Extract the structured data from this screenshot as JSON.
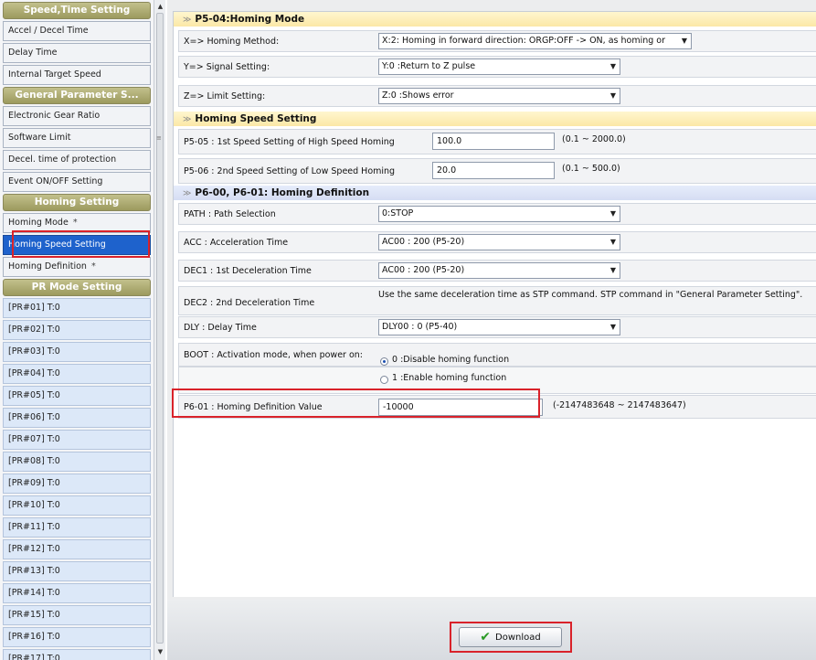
{
  "sidebar": {
    "groups": [
      {
        "title": "Speed,Time Setting",
        "items": [
          {
            "label": "Accel / Decel Time"
          },
          {
            "label": "Delay Time"
          },
          {
            "label": "Internal Target Speed"
          }
        ]
      },
      {
        "title": "General Parameter S...",
        "items": [
          {
            "label": "Electronic Gear Ratio"
          },
          {
            "label": "Software Limit"
          },
          {
            "label": "Decel. time of protection"
          },
          {
            "label": "Event ON/OFF Setting"
          }
        ]
      },
      {
        "title": "Homing Setting",
        "items": [
          {
            "label": "Homing Mode",
            "star": "*"
          },
          {
            "label": "Homing Speed Setting",
            "selected": true
          },
          {
            "label": "Homing Definition",
            "star": "*"
          }
        ]
      },
      {
        "title": "PR Mode Setting",
        "items": []
      }
    ],
    "pr_items": [
      "[PR#01]   T:0",
      "[PR#02]   T:0",
      "[PR#03]   T:0",
      "[PR#04]   T:0",
      "[PR#05]   T:0",
      "[PR#06]   T:0",
      "[PR#07]   T:0",
      "[PR#08]   T:0",
      "[PR#09]   T:0",
      "[PR#10]   T:0",
      "[PR#11]   T:0",
      "[PR#12]   T:0",
      "[PR#13]   T:0",
      "[PR#14]   T:0",
      "[PR#15]   T:0",
      "[PR#16]   T:0",
      "[PR#17]   T:0"
    ]
  },
  "homing_mode": {
    "title": "P5-04:Homing Mode",
    "method_label": "X=> Homing Method:",
    "method_value": "X:2: Homing in forward direction: ORGP:OFF -> ON, as homing or",
    "signal_label": "Y=> Signal Setting:",
    "signal_value": "Y:0 :Return to Z pulse",
    "limit_label": "Z=> Limit Setting:",
    "limit_value": "Z:0 :Shows error"
  },
  "homing_speed": {
    "title": "Homing Speed Setting",
    "high_label": "P5-05 : 1st Speed Setting of High Speed Homing",
    "high_value": "100.0",
    "high_range": "(0.1 ~ 2000.0)",
    "low_label": "P5-06 : 2nd Speed Setting of Low Speed Homing",
    "low_value": "20.0",
    "low_range": "(0.1 ~ 500.0)"
  },
  "homing_definition": {
    "title": "P6-00, P6-01: Homing Definition",
    "path_label": "PATH : Path Selection",
    "path_value": "0:STOP",
    "acc_label": "ACC : Acceleration Time",
    "acc_value": "AC00 : 200 (P5-20)",
    "dec1_label": "DEC1 : 1st Deceleration Time",
    "dec1_value": "AC00 : 200 (P5-20)",
    "dec2_label": "DEC2 : 2nd Deceleration Time",
    "dec2_note": "Use the same deceleration time as STP command. STP command in \"General Parameter Setting\".",
    "dly_label": "DLY : Delay Time",
    "dly_value": "DLY00 : 0 (P5-40)",
    "boot_label": "BOOT : Activation mode, when power on:",
    "boot_option0": "0 :Disable homing function",
    "boot_option1": "1 :Enable homing function",
    "boot_selected": 0,
    "p601_label": "P6-01 : Homing Definition Value",
    "p601_value": "-10000",
    "p601_range": "(-2147483648 ~ 2147483647)"
  },
  "footer": {
    "download_label": "Download"
  },
  "colors": {
    "highlight": "#d9222a",
    "selected": "#1e62cc",
    "section_yellow": "#fbe8a6",
    "section_blue": "#d5ddf3"
  }
}
